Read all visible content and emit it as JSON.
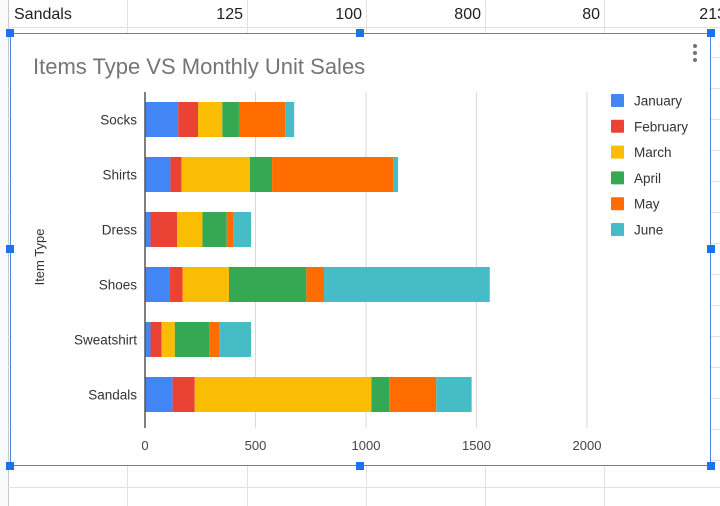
{
  "sheet": {
    "visible_row": {
      "cells": [
        "Sandals",
        "125",
        "100",
        "800",
        "80",
        "213"
      ]
    }
  },
  "chart_data": {
    "type": "bar",
    "orientation": "horizontal",
    "stacked": true,
    "title": "Items Type VS Monthly Unit Sales",
    "xlabel": "",
    "ylabel": "Item Type",
    "xlim": [
      0,
      2000
    ],
    "xticks": [
      "0",
      "500",
      "1000",
      "1500",
      "2000"
    ],
    "xtick_values": [
      0,
      500,
      1000,
      1500,
      2000
    ],
    "grid": true,
    "legend_position": "right",
    "categories": [
      "Socks",
      "Shirts",
      "Dress",
      "Shoes",
      "Sweatshirt",
      "Sandals"
    ],
    "series": [
      {
        "name": "January",
        "color": "#4285f4",
        "values": [
          150,
          115,
          25,
          110,
          25,
          125
        ]
      },
      {
        "name": "February",
        "color": "#ea4335",
        "values": [
          90,
          50,
          120,
          60,
          50,
          100
        ]
      },
      {
        "name": "March",
        "color": "#fbbc04",
        "values": [
          110,
          310,
          115,
          210,
          60,
          800
        ]
      },
      {
        "name": "April",
        "color": "#34a853",
        "values": [
          75,
          100,
          110,
          350,
          155,
          80
        ]
      },
      {
        "name": "May",
        "color": "#ff6d01",
        "values": [
          210,
          550,
          30,
          80,
          45,
          213
        ]
      },
      {
        "name": "June",
        "color": "#46bdc6",
        "values": [
          40,
          20,
          80,
          750,
          145,
          160
        ]
      }
    ]
  }
}
